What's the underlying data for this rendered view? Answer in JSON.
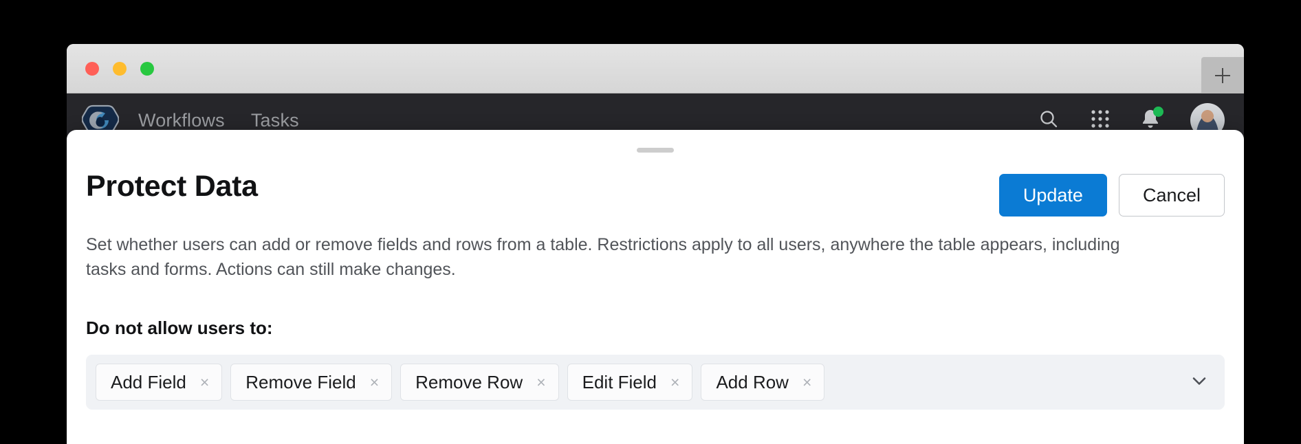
{
  "window": {
    "traffic_lights": [
      "close",
      "minimize",
      "maximize"
    ],
    "new_tab_label": "+"
  },
  "app_nav": {
    "logo_name": "app-logo",
    "links": [
      {
        "label": "Workflows"
      },
      {
        "label": "Tasks"
      }
    ],
    "icons": [
      {
        "name": "search-icon"
      },
      {
        "name": "apps-grid-icon"
      },
      {
        "name": "notifications-bell-icon",
        "badge": true
      },
      {
        "name": "user-avatar"
      }
    ]
  },
  "modal": {
    "title": "Protect Data",
    "description": "Set whether users can add or remove fields and rows from a table. Restrictions apply to all users, anywhere the table appears, including tasks and forms. Actions can still make changes.",
    "update_label": "Update",
    "cancel_label": "Cancel",
    "section_label": "Do not allow users to:",
    "chips": [
      {
        "label": "Add Field",
        "remove": "×"
      },
      {
        "label": "Remove Field",
        "remove": "×"
      },
      {
        "label": "Remove Row",
        "remove": "×"
      },
      {
        "label": "Edit Field",
        "remove": "×"
      },
      {
        "label": "Add Row",
        "remove": "×"
      }
    ]
  },
  "colors": {
    "primary_blue": "#0b7bd4",
    "nav_dark": "#26262a",
    "field_bg": "#f0f2f5",
    "badge_green": "#1db954"
  }
}
